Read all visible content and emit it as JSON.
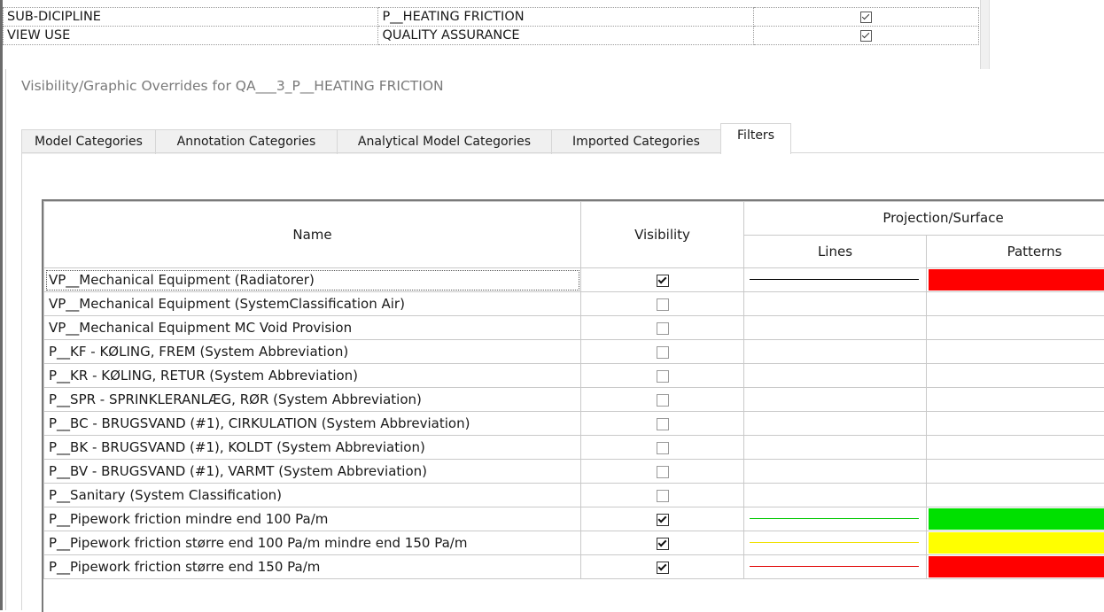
{
  "properties": {
    "rows": [
      {
        "label": "SUB-DICIPLINE",
        "value": "P__HEATING FRICTION",
        "checked": true
      },
      {
        "label": "VIEW USE",
        "value": "QUALITY ASSURANCE",
        "checked": true
      }
    ]
  },
  "dialog": {
    "title": "Visibility/Graphic Overrides for QA___3_P__HEATING FRICTION",
    "tabs": [
      {
        "label": "Model Categories"
      },
      {
        "label": "Annotation Categories"
      },
      {
        "label": "Analytical Model Categories"
      },
      {
        "label": "Imported Categories"
      },
      {
        "label": "Filters",
        "active": true
      }
    ]
  },
  "grid": {
    "headers": {
      "name": "Name",
      "visibility": "Visibility",
      "group": "Projection/Surface",
      "lines": "Lines",
      "patterns": "Patterns"
    },
    "rows": [
      {
        "name": "VP__Mechanical Equipment (Radiatorer)",
        "visible": true,
        "line_color": "#000000",
        "pattern_color": "#ff0000"
      },
      {
        "name": "VP__Mechanical Equipment (SystemClassification Air)",
        "visible": false,
        "line_color": null,
        "pattern_color": null
      },
      {
        "name": "VP__Mechanical Equipment MC Void Provision",
        "visible": false,
        "line_color": null,
        "pattern_color": null
      },
      {
        "name": "P__KF - KØLING, FREM (System Abbreviation)",
        "visible": false,
        "line_color": null,
        "pattern_color": null
      },
      {
        "name": "P__KR - KØLING, RETUR (System Abbreviation)",
        "visible": false,
        "line_color": null,
        "pattern_color": null
      },
      {
        "name": "P__SPR - SPRINKLERANLÆG, RØR (System Abbreviation)",
        "visible": false,
        "line_color": null,
        "pattern_color": null
      },
      {
        "name": "P__BC - BRUGSVAND (#1), CIRKULATION (System Abbreviation)",
        "visible": false,
        "line_color": null,
        "pattern_color": null
      },
      {
        "name": "P__BK - BRUGSVAND (#1), KOLDT (System Abbreviation)",
        "visible": false,
        "line_color": null,
        "pattern_color": null
      },
      {
        "name": "P__BV - BRUGSVAND (#1), VARMT (System Abbreviation)",
        "visible": false,
        "line_color": null,
        "pattern_color": null
      },
      {
        "name": "P__Sanitary (System Classification)",
        "visible": false,
        "line_color": null,
        "pattern_color": null
      },
      {
        "name": "P__Pipework friction mindre end 100 Pa/m",
        "visible": true,
        "line_color": "#00c800",
        "pattern_color": "#00e000"
      },
      {
        "name": "P__Pipework friction større end 100 Pa/m mindre end 150 Pa/m",
        "visible": true,
        "line_color": "#f0e000",
        "pattern_color": "#ffff00"
      },
      {
        "name": "P__Pipework friction større end 150 Pa/m",
        "visible": true,
        "line_color": "#e00000",
        "pattern_color": "#ff0000"
      }
    ]
  }
}
